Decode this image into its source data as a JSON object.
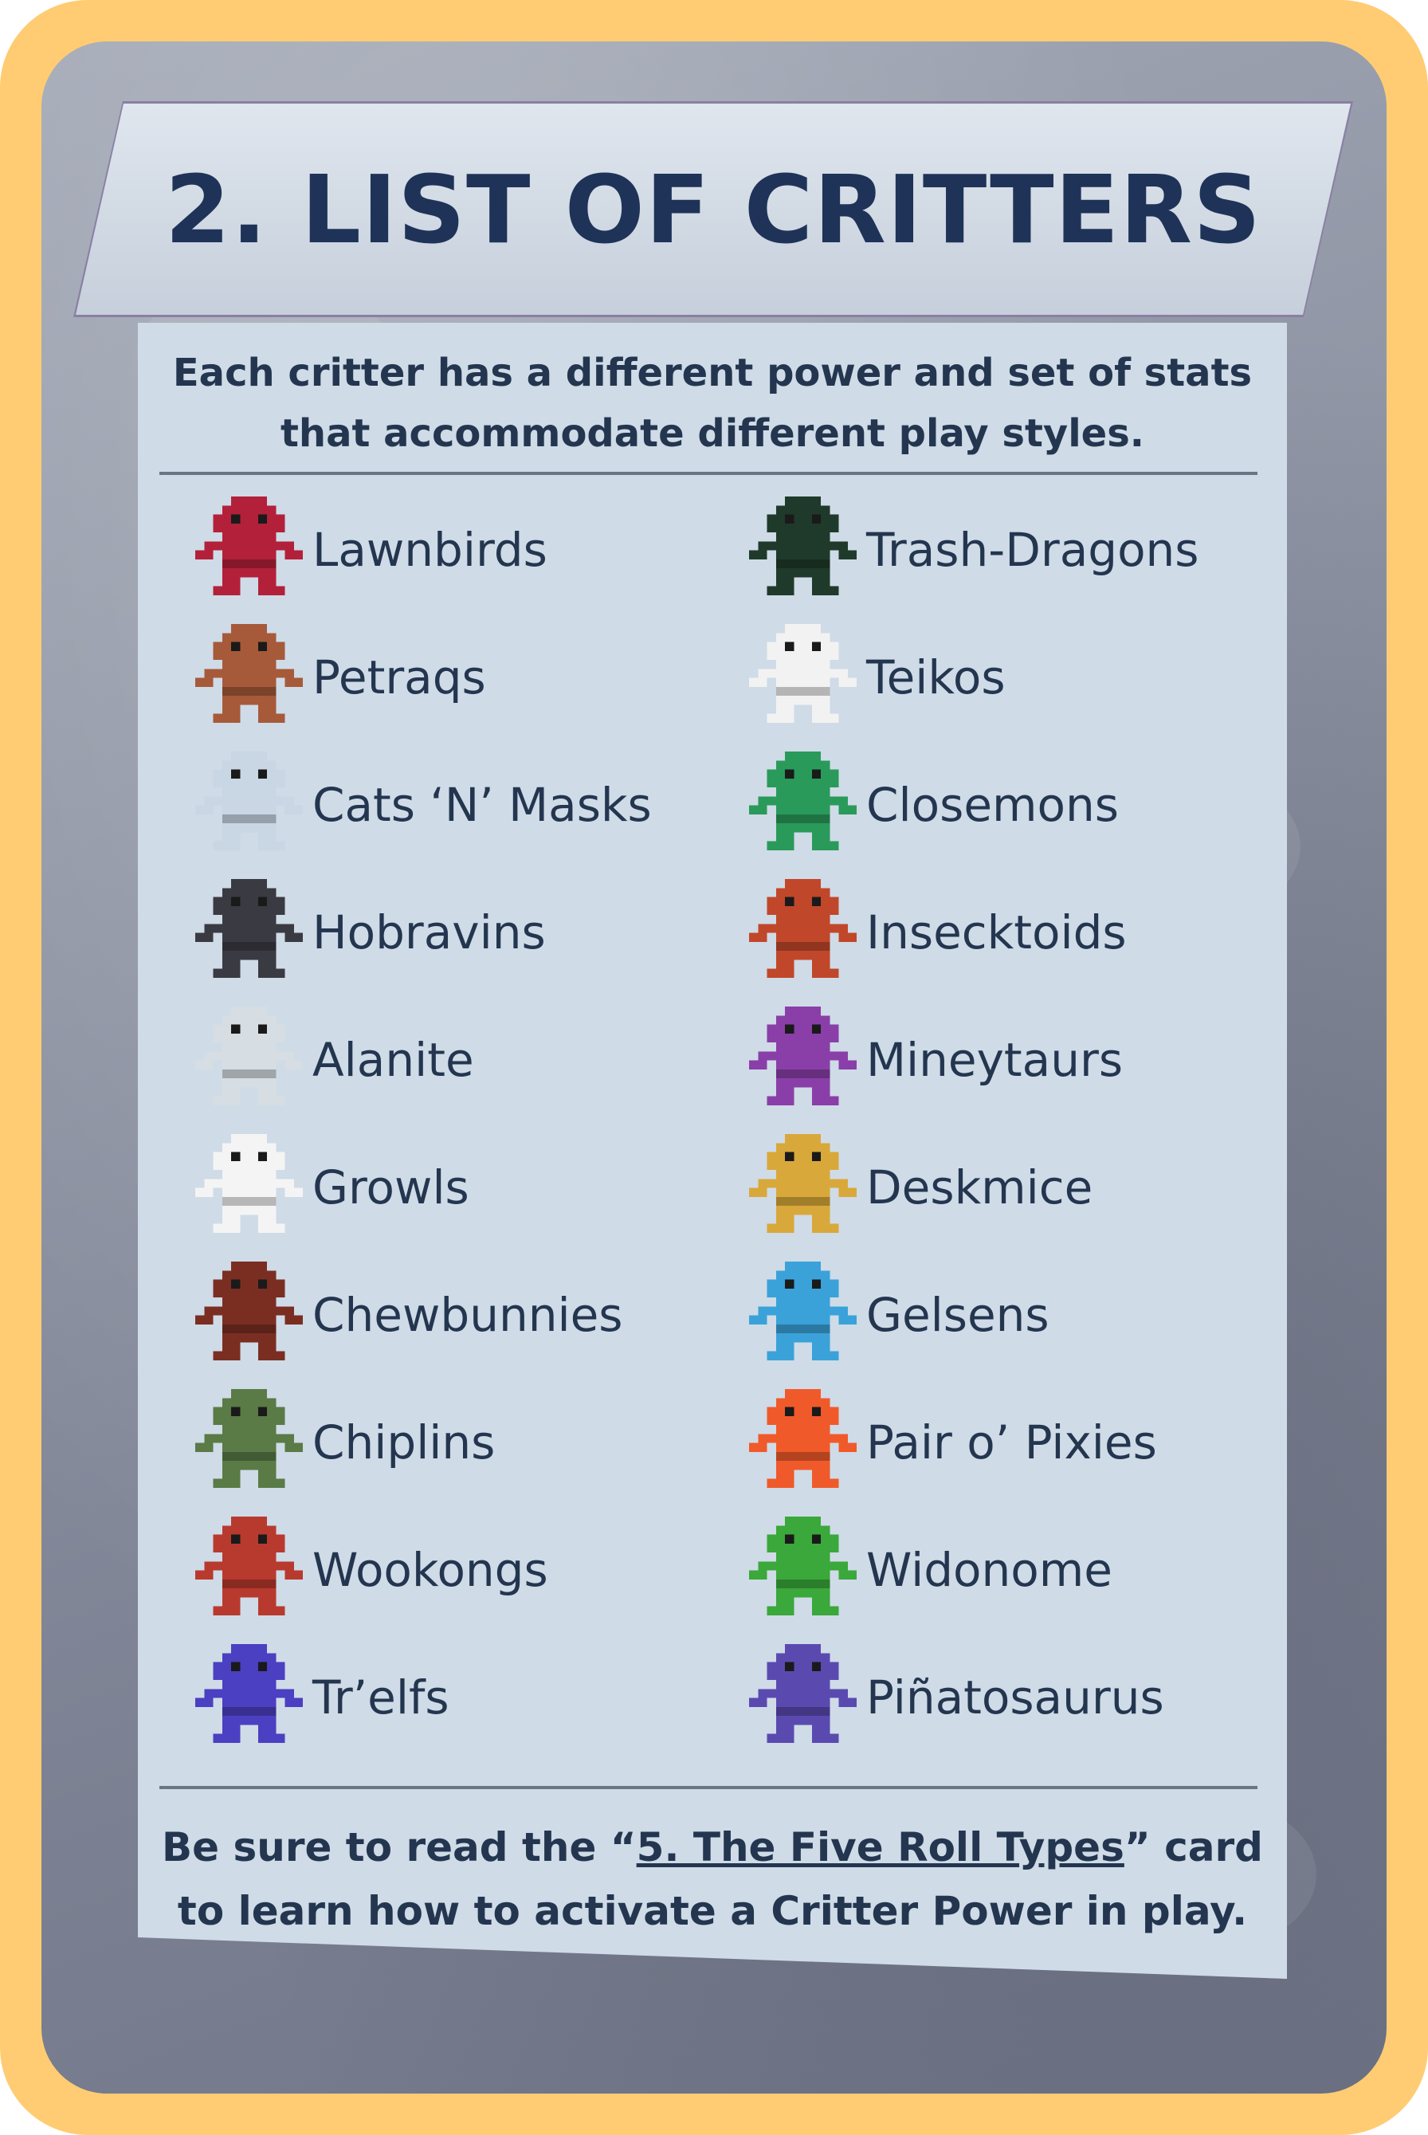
{
  "title": "2. LIST OF CRITTERS",
  "intro": {
    "line1": "Each critter has a different power and set of stats",
    "line2": "that accommodate different play styles."
  },
  "critters_left": [
    {
      "name": "Lawnbirds",
      "color": "#b3203a"
    },
    {
      "name": "Petraqs",
      "color": "#a65a3a"
    },
    {
      "name": "Cats ‘N’ Masks",
      "color": "#c9d6e3"
    },
    {
      "name": "Hobravins",
      "color": "#3a3a42"
    },
    {
      "name": "Alanite",
      "color": "#d6dde3"
    },
    {
      "name": "Growls",
      "color": "#f4f4f4"
    },
    {
      "name": "Chewbunnies",
      "color": "#7a2e22"
    },
    {
      "name": "Chiplins",
      "color": "#5a7a46"
    },
    {
      "name": "Wookongs",
      "color": "#b83a2e"
    },
    {
      "name": "Tr’elfs",
      "color": "#4b3fc2"
    }
  ],
  "critters_right": [
    {
      "name": "Trash-Dragons",
      "color": "#1f3a2a"
    },
    {
      "name": "Teikos",
      "color": "#f2f2f2"
    },
    {
      "name": "Closemons",
      "color": "#2a9a5a"
    },
    {
      "name": "Insecktoids",
      "color": "#c0472a"
    },
    {
      "name": "Mineytaurs",
      "color": "#8a3fa8"
    },
    {
      "name": "Deskmice",
      "color": "#d9a83a"
    },
    {
      "name": "Gelsens",
      "color": "#3aa2d9"
    },
    {
      "name": "Pair o’ Pixies",
      "color": "#f05a2a"
    },
    {
      "name": "Widonome",
      "color": "#3aa83a"
    },
    {
      "name": "Piñatosaurus",
      "color": "#5a4ab0"
    }
  ],
  "footer": {
    "pre": "Be sure to read the “",
    "link": "5. The Five Roll Types",
    "post": "” card",
    "line2": "to learn how to activate a Critter Power in play."
  }
}
